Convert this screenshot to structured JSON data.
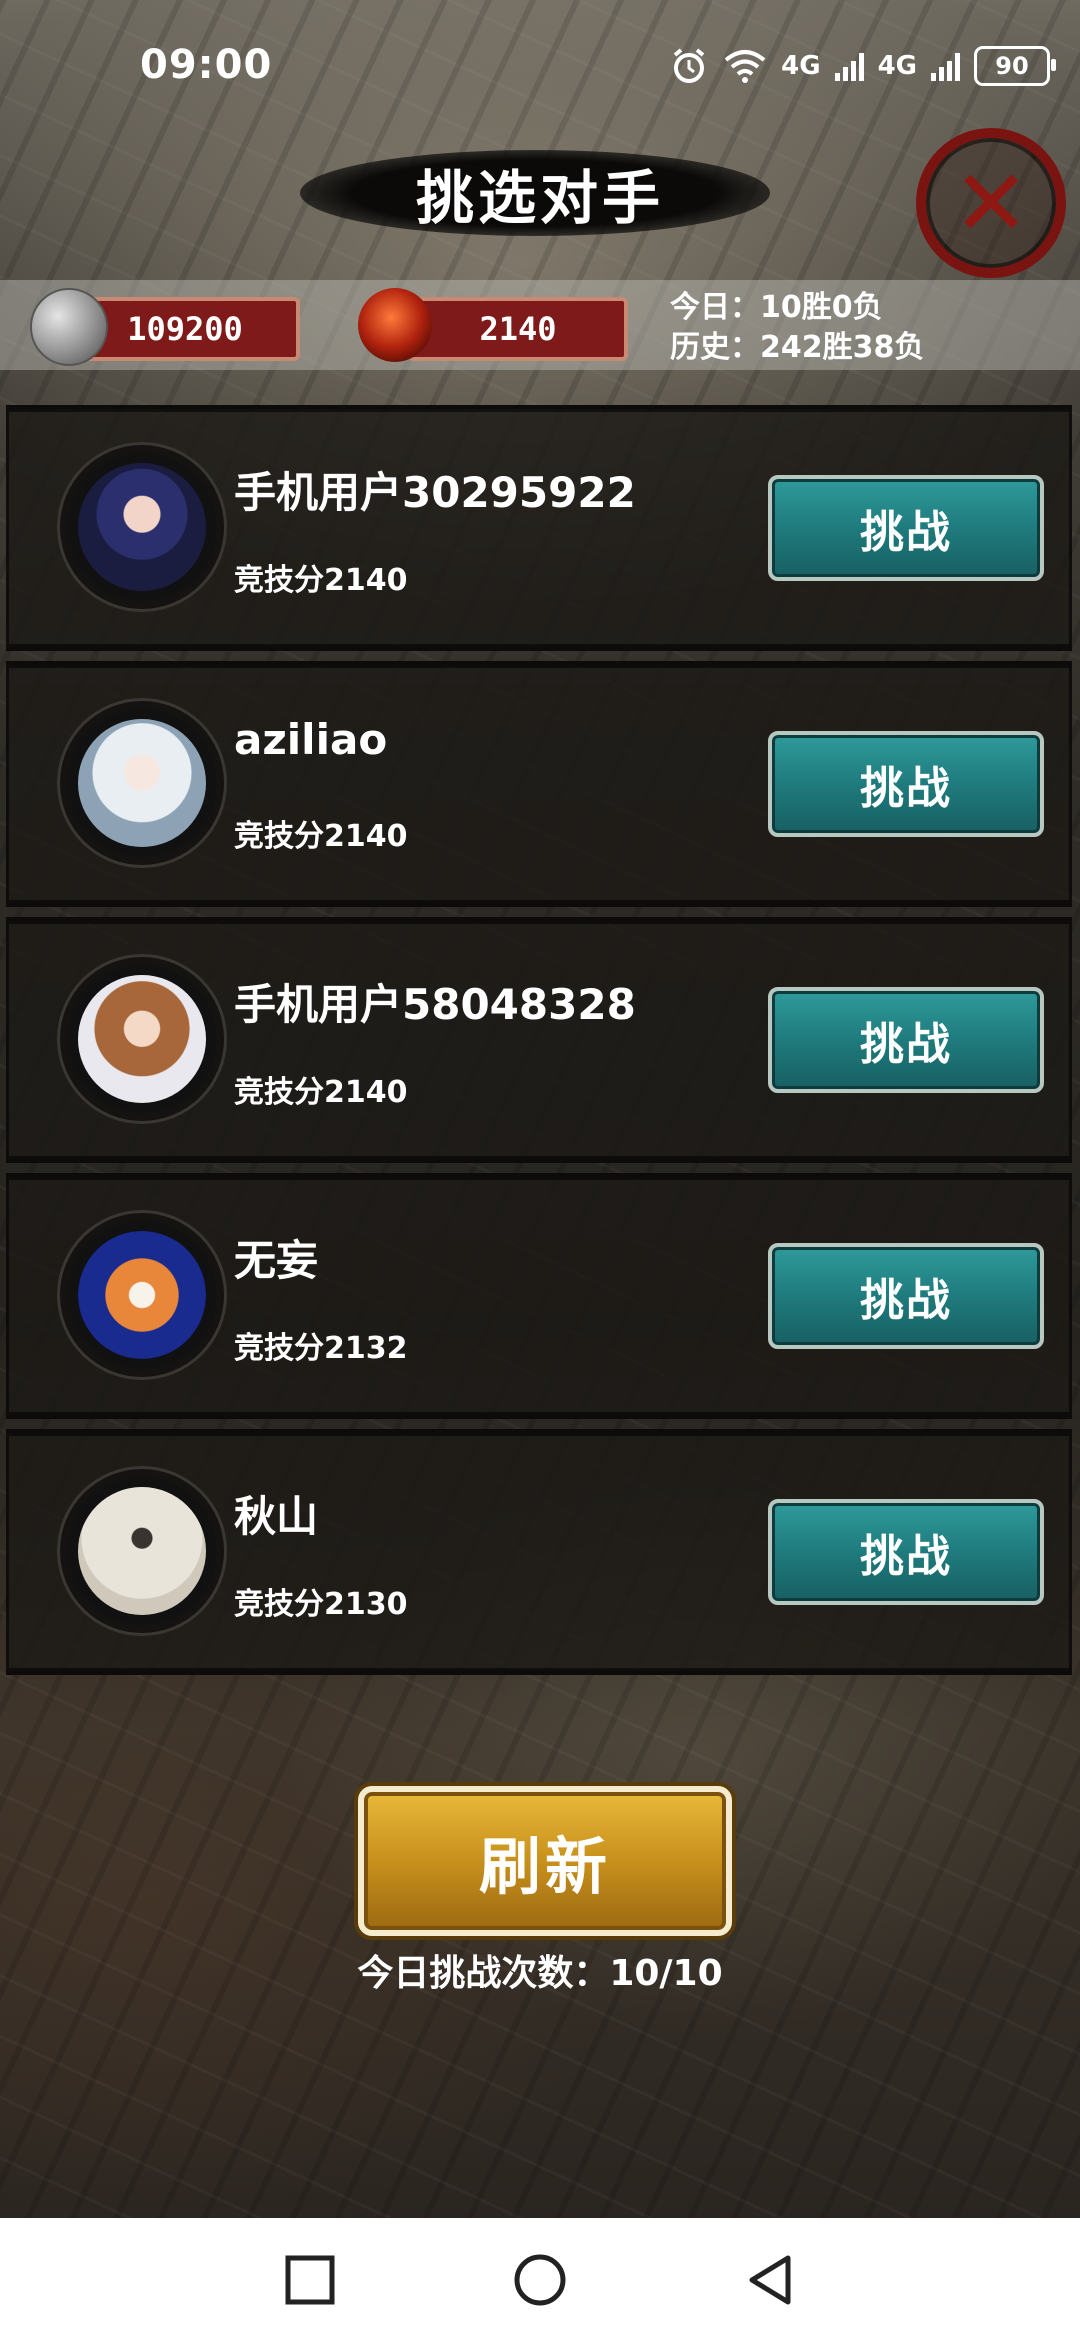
{
  "status_bar": {
    "time": "09:00",
    "net_1": "4G",
    "net_2": "4G",
    "battery": "90",
    "icons": [
      "alarm-icon",
      "wifi-icon",
      "signal-icon",
      "signal-icon",
      "battery-icon"
    ]
  },
  "header": {
    "title": "挑选对手",
    "close_icon": "close-icon"
  },
  "resources": {
    "coins": "109200",
    "rank_points": "2140",
    "today_record": "今日：10胜0负",
    "history_record": "历史：242胜38负"
  },
  "opponents": [
    {
      "name": "手机用户30295922",
      "score": "竞技分2140",
      "button": "挑战"
    },
    {
      "name": "aziliao",
      "score": "竞技分2140",
      "button": "挑战"
    },
    {
      "name": "手机用户58048328",
      "score": "竞技分2140",
      "button": "挑战"
    },
    {
      "name": "无妄",
      "score": "竞技分2132",
      "button": "挑战"
    },
    {
      "name": "秋山",
      "score": "竞技分2130",
      "button": "挑战"
    }
  ],
  "footer": {
    "refresh_label": "刷新",
    "challenge_count": "今日挑战次数：10/10"
  },
  "colors": {
    "accent_teal": "#1f7b7d",
    "gold": "#c8901c",
    "red": "#7f1a1a"
  }
}
